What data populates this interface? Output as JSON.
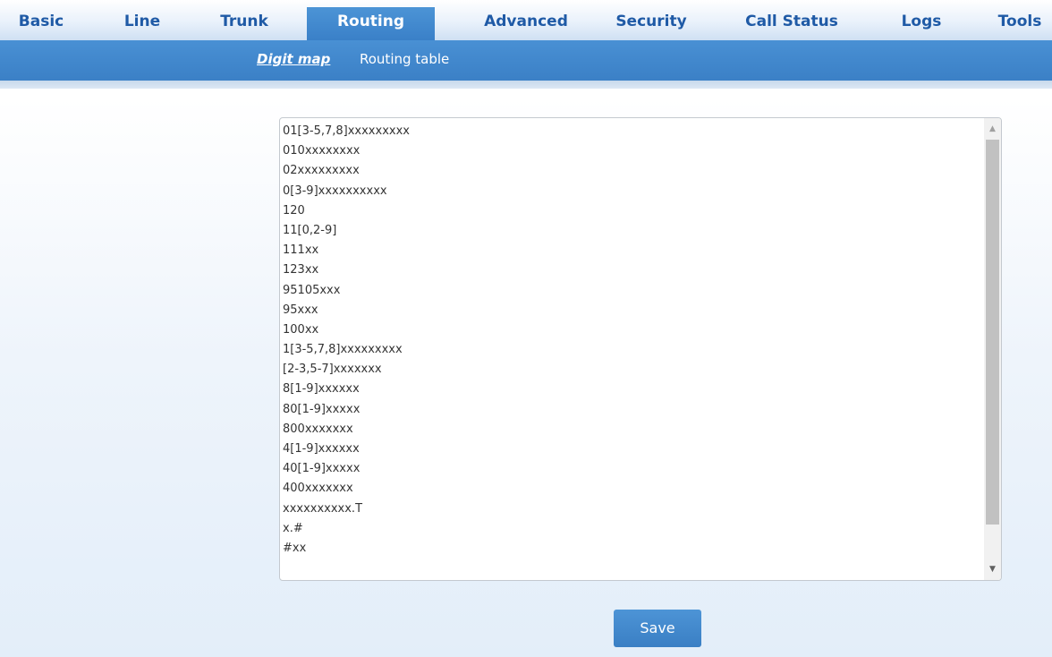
{
  "topnav": {
    "items": [
      {
        "label": "Basic"
      },
      {
        "label": "Line"
      },
      {
        "label": "Trunk"
      },
      {
        "label": "Routing",
        "active": true
      },
      {
        "label": "Advanced"
      },
      {
        "label": "Security"
      },
      {
        "label": "Call Status"
      },
      {
        "label": "Logs"
      },
      {
        "label": "Tools"
      }
    ]
  },
  "subnav": {
    "items": [
      {
        "label": "Digit map",
        "active": true
      },
      {
        "label": "Routing table"
      }
    ]
  },
  "digitmap": {
    "lines": [
      "01[3-5,7,8]xxxxxxxxx",
      "010xxxxxxxx",
      "02xxxxxxxxx",
      "0[3-9]xxxxxxxxxx",
      "120",
      "11[0,2-9]",
      "111xx",
      "123xx",
      "95105xxx",
      "95xxx",
      "100xx",
      "1[3-5,7,8]xxxxxxxxx",
      "[2-3,5-7]xxxxxxx",
      "8[1-9]xxxxxx",
      "80[1-9]xxxxx",
      "800xxxxxxx",
      "4[1-9]xxxxxx",
      "40[1-9]xxxxx",
      "400xxxxxxx",
      "xxxxxxxxxx.T",
      "x.#",
      "#xx"
    ]
  },
  "actions": {
    "save_label": "Save"
  },
  "colors": {
    "accent": "#3b80c6",
    "nav_text": "#1f5aa6"
  },
  "icons": {
    "scroll_up": "scroll-up-arrow-icon",
    "scroll_down": "scroll-down-arrow-icon"
  }
}
